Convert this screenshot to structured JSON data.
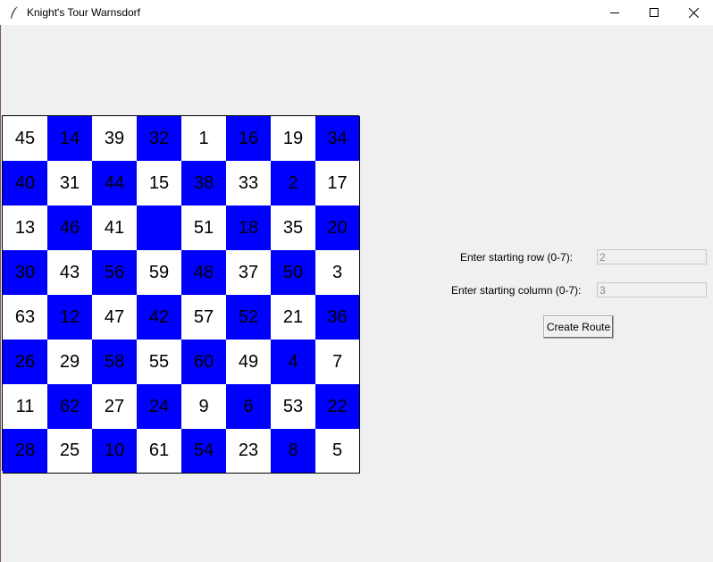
{
  "window": {
    "title": "Knight's Tour Warnsdorf",
    "controls": [
      "minimize",
      "maximize",
      "close"
    ]
  },
  "board": {
    "rows": [
      [
        "45",
        "14",
        "39",
        "32",
        "1",
        "16",
        "19",
        "34"
      ],
      [
        "40",
        "31",
        "44",
        "15",
        "38",
        "33",
        "2",
        "17"
      ],
      [
        "13",
        "46",
        "41",
        "",
        "51",
        "18",
        "35",
        "20"
      ],
      [
        "30",
        "43",
        "56",
        "59",
        "48",
        "37",
        "50",
        "3"
      ],
      [
        "63",
        "12",
        "47",
        "42",
        "57",
        "52",
        "21",
        "36"
      ],
      [
        "26",
        "29",
        "58",
        "55",
        "60",
        "49",
        "4",
        "7"
      ],
      [
        "11",
        "62",
        "27",
        "24",
        "9",
        "6",
        "53",
        "22"
      ],
      [
        "28",
        "25",
        "10",
        "61",
        "54",
        "23",
        "8",
        "5"
      ]
    ],
    "colors": {
      "dark": "#0000ff",
      "light": "#ffffff"
    }
  },
  "form": {
    "row_label": "Enter starting row (0-7):",
    "row_value": "2",
    "col_label": "Enter starting column (0-7):",
    "col_value": "3",
    "button_label": "Create Route"
  }
}
